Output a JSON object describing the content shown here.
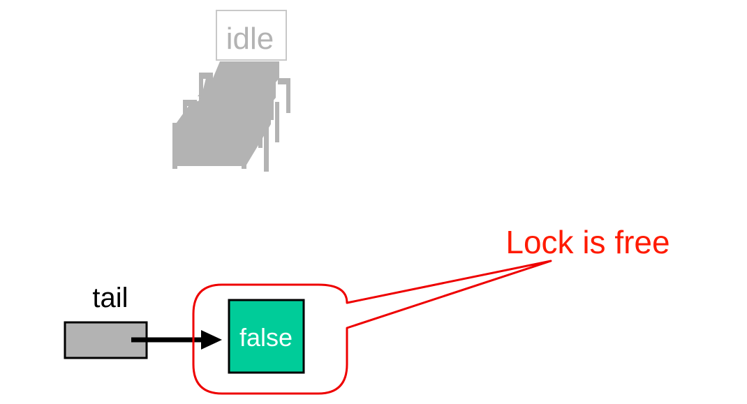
{
  "threads": {
    "label": "idle"
  },
  "queue": {
    "tail_label": "tail",
    "node_value": "false"
  },
  "callout": {
    "text": "Lock is free"
  },
  "colors": {
    "idle_gray": "#b3b3b3",
    "idle_border": "#c8c8c8",
    "tail_fill": "#b3b3b3",
    "node_fill": "#00cc99",
    "node_text": "#ffffff",
    "callout_red": "#ff1a00",
    "callout_stroke": "#ee0000",
    "arrow": "#000000"
  }
}
